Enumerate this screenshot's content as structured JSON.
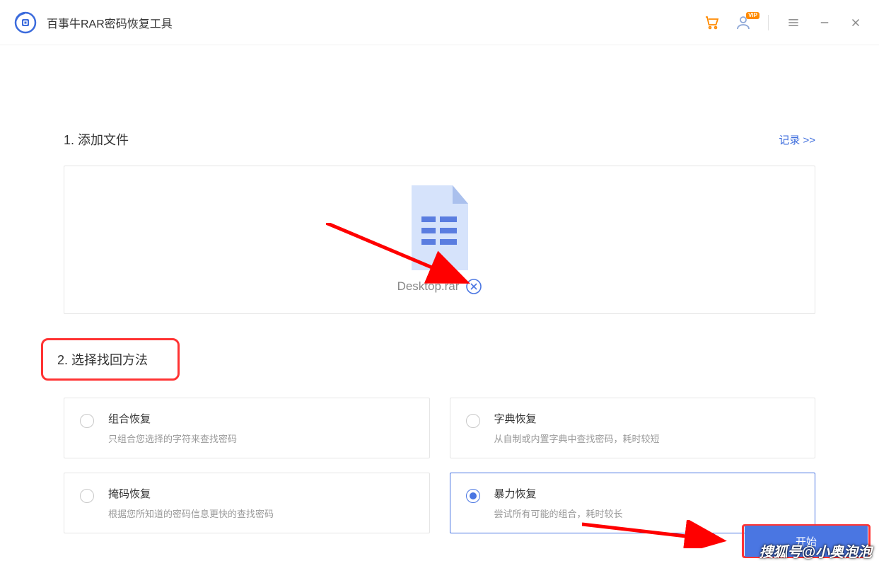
{
  "header": {
    "app_title": "百事牛RAR密码恢复工具",
    "vip_badge": "VIP"
  },
  "section1": {
    "title": "1. 添加文件",
    "records_link": "记录 >>",
    "file_name": "Desktop.rar"
  },
  "section2": {
    "title": "2. 选择找回方法",
    "methods": [
      {
        "title": "组合恢复",
        "desc": "只组合您选择的字符来查找密码",
        "selected": false
      },
      {
        "title": "字典恢复",
        "desc": "从自制或内置字典中查找密码，耗时较短",
        "selected": false
      },
      {
        "title": "掩码恢复",
        "desc": "根据您所知道的密码信息更快的查找密码",
        "selected": false
      },
      {
        "title": "暴力恢复",
        "desc": "尝试所有可能的组合，耗时较长",
        "selected": true
      }
    ]
  },
  "footer": {
    "start_button": "开始"
  },
  "watermark": "搜狐号@小奥泡泡"
}
